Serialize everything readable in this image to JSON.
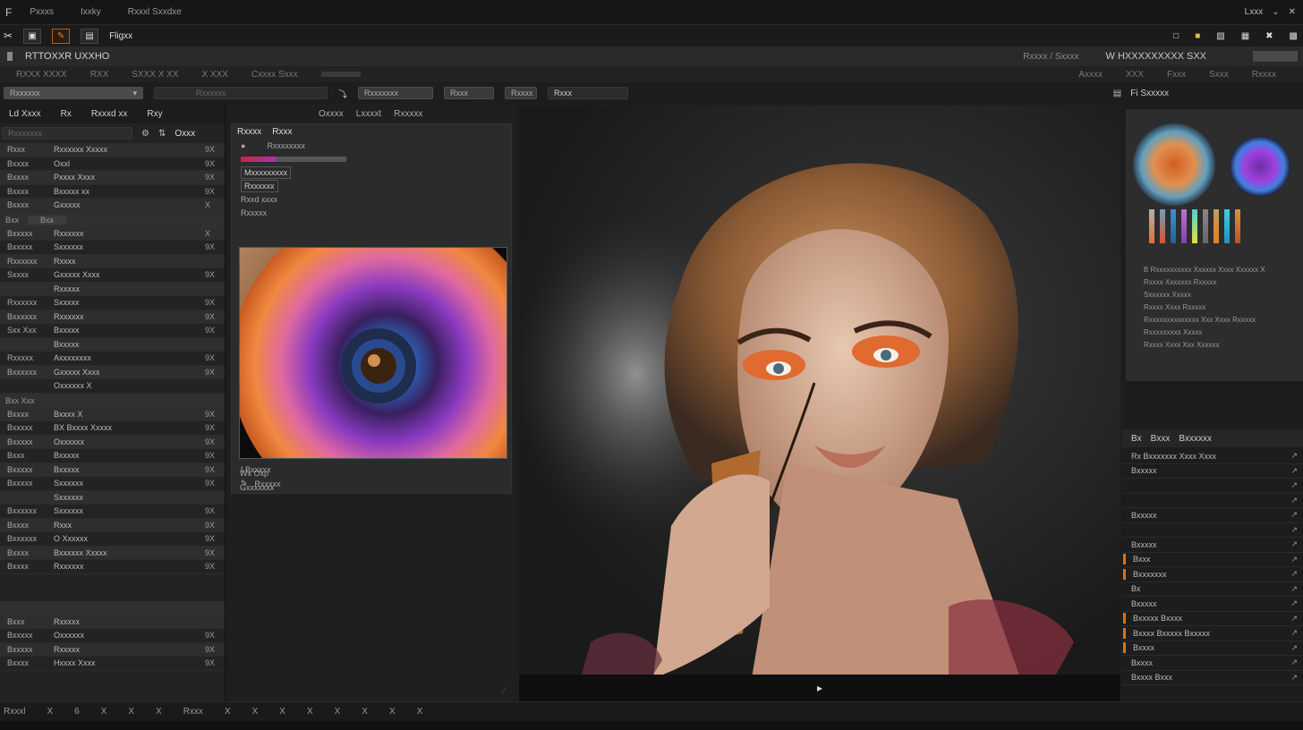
{
  "app": {
    "logo": "F",
    "menus": [
      "Pxxxs",
      "Ixxky",
      "Rxxxl Sxxdxe"
    ],
    "right_label": "Lxxx"
  },
  "toolbar": {
    "tool_label": "Fligxx"
  },
  "title": {
    "doc_title": "RTTOXXR UXXHO",
    "crumb": "Rxxxx / Sxxxx",
    "right_title": "W HXXXXXXXXX SXX"
  },
  "options": {
    "items": [
      "RXXX XXXX",
      "RXX",
      "SXXX X XX",
      "X XXX",
      "Cxxxx Sxxx"
    ],
    "right_items": [
      "Axxxx",
      "XXX",
      "Fxxx",
      "Sxxx",
      "Rxxxx"
    ]
  },
  "subbar": {
    "field1": "Rxxxxxx",
    "field2": "Rxxxxxx",
    "field3": "Rxxxxxxx",
    "field4": "Rxxx",
    "field5": "Rxxxx",
    "field6": "Rxxx",
    "right_label": "Fi Sxxxxx"
  },
  "left_panel": {
    "header": [
      "Ld Xxxx",
      "Rx",
      "Rxxxd xx",
      "Rxy"
    ],
    "search_placeholder": "Rxxxxxxx",
    "search_right": "Oxxx",
    "section1_rows": [
      {
        "a": "Rxxx",
        "b": "Rxxxxxx Xxxxx",
        "c": "9X"
      },
      {
        "a": "Bxxxx",
        "b": "Oxxl",
        "c": "9X"
      },
      {
        "a": "Bxxxx",
        "b": "Pxxxx Xxxx",
        "c": "9X"
      },
      {
        "a": "Bxxxx",
        "b": "Bxxxxx xx",
        "c": "9X"
      },
      {
        "a": "Bxxxx",
        "b": "Gxxxxx",
        "c": "X"
      }
    ],
    "section2_label": "Bxx",
    "section2_tab": "Bxx",
    "section2_rows": [
      {
        "a": "Bxxxxx",
        "b": "Rxxxxxx",
        "c": "X"
      },
      {
        "a": "Bxxxxx",
        "b": "Sxxxxxx",
        "c": "9X"
      },
      {
        "a": "Rxxxxxx",
        "b": "Rxxxx",
        "c": ""
      },
      {
        "a": "Sxxxx",
        "b": "Gxxxxx Xxxx",
        "c": "9X"
      },
      {
        "a": "",
        "b": "Rxxxxx",
        "c": ""
      },
      {
        "a": "Rxxxxxx",
        "b": "Sxxxxx",
        "c": "9X"
      },
      {
        "a": "Bxxxxxx",
        "b": "Rxxxxxx",
        "c": "9X"
      },
      {
        "a": "Sxx Xxx",
        "b": "Bxxxxx",
        "c": "9X"
      },
      {
        "a": "",
        "b": "Bxxxxx",
        "c": ""
      },
      {
        "a": "Rxxxxx",
        "b": "Axxxxxxxx",
        "c": "9X"
      },
      {
        "a": "Bxxxxxx",
        "b": "Gxxxxx Xxxx",
        "c": "9X"
      },
      {
        "a": "",
        "b": "Oxxxxxx X",
        "c": ""
      }
    ],
    "section3_label": "Bxx Xxx",
    "section3_rows": [
      {
        "a": "Bxxxx",
        "b": "Bxxxx X",
        "c": "9X"
      },
      {
        "a": "Bxxxxx",
        "b": "BX Bxxxx Xxxxx",
        "c": "9X"
      },
      {
        "a": "Bxxxxx",
        "b": "Oxxxxxx",
        "c": "9X"
      },
      {
        "a": "Bxxx",
        "b": "Bxxxxx",
        "c": "9X"
      },
      {
        "a": "Bxxxxx",
        "b": "Bxxxxx",
        "c": "9X"
      },
      {
        "a": "Bxxxxx",
        "b": "Sxxxxxx",
        "c": "9X"
      },
      {
        "a": "",
        "b": "Sxxxxxx",
        "c": ""
      },
      {
        "a": "Bxxxxxx",
        "b": "Sxxxxxx",
        "c": "9X"
      },
      {
        "a": "Bxxxx",
        "b": "Rxxx",
        "c": "9X"
      },
      {
        "a": "Bxxxxxx",
        "b": "O Xxxxxx",
        "c": "9X"
      },
      {
        "a": "Bxxxx",
        "b": "Bxxxxxx Xxxxx",
        "c": "9X"
      },
      {
        "a": "Bxxxx",
        "b": "Rxxxxxx",
        "c": "9X"
      }
    ],
    "section4_rows": [
      {
        "a": "Bxxx",
        "b": "Rxxxxx",
        "c": ""
      },
      {
        "a": "Bxxxxx",
        "b": "Oxxxxxx",
        "c": "9X"
      },
      {
        "a": "Bxxxxx",
        "b": "Rxxxxx",
        "c": "9X"
      },
      {
        "a": "Bxxxx",
        "b": "Hxxxx Xxxx",
        "c": "9X"
      }
    ]
  },
  "mid_panel": {
    "header": [
      "Oxxxx",
      "Lxxxxt",
      "Rxxxxx"
    ],
    "tabs": [
      "Rxxxx",
      "Rxxx"
    ],
    "line1": "Rxxxxxxxx",
    "line2": "Mxxxxxxxxx",
    "line3": "Rxxxxxx",
    "line4": "Rxxd xxxx",
    "line5": "Rxxxxx",
    "footer1": "I Bxxxxx",
    "footer2": "Rxxxxx",
    "footer3": "Wx Oxp",
    "footer4": "Gxxxxxxx",
    "progress": 0.34
  },
  "canvas": {
    "play_symbol": "▸"
  },
  "right_panel": {
    "header": "Fi Sxxxxx",
    "lines": [
      "B Rxxxxxxxxxx Xxxxxx Xxxx Xxxxxx X",
      "Rxxxx Xxxxxxx Rxxxxx",
      "Sxxxxxx Xxxxx",
      "Rxxxx Xxxx Rxxxxx",
      "Rxxxxxxxxxxxxxx Xxx Xxxx Rxxxxx",
      "Rxxxxxxxxx Xxxxx",
      "Rxxxx Xxxx Xxx Xxxxxx"
    ],
    "layers_header": [
      "Bx",
      "Bxxx",
      "Bxxxxxx"
    ],
    "layers": [
      {
        "name": "Rx Bxxxxxxx Xxxx Xxxx",
        "marked": false
      },
      {
        "name": "Bxxxxx",
        "marked": false
      },
      {
        "name": "",
        "marked": false
      },
      {
        "name": "",
        "marked": false
      },
      {
        "name": "Bxxxxx",
        "marked": false
      },
      {
        "name": "",
        "marked": false
      },
      {
        "name": "Bxxxxx",
        "marked": false
      },
      {
        "name": "Bxxx",
        "marked": true
      },
      {
        "name": "Bxxxxxxx",
        "marked": true
      },
      {
        "name": "Bx",
        "marked": false
      },
      {
        "name": "Bxxxxx",
        "marked": false
      },
      {
        "name": "Bxxxxx Bxxxx",
        "marked": true
      },
      {
        "name": "Bxxxx Bxxxxx Bxxxxx",
        "marked": true
      },
      {
        "name": "Bxxxx",
        "marked": true
      },
      {
        "name": "Bxxxx",
        "marked": false
      },
      {
        "name": "Bxxxx Bxxx",
        "marked": false
      }
    ]
  },
  "statusbar": {
    "items": [
      "Rxxxl",
      "X",
      "6",
      "X",
      "X",
      "X",
      "Rxxx",
      "X",
      "X",
      "X",
      "X",
      "X",
      "X",
      "X",
      "X"
    ]
  },
  "colors": {
    "accent": "#e07010",
    "bg": "#1e1e1e"
  }
}
